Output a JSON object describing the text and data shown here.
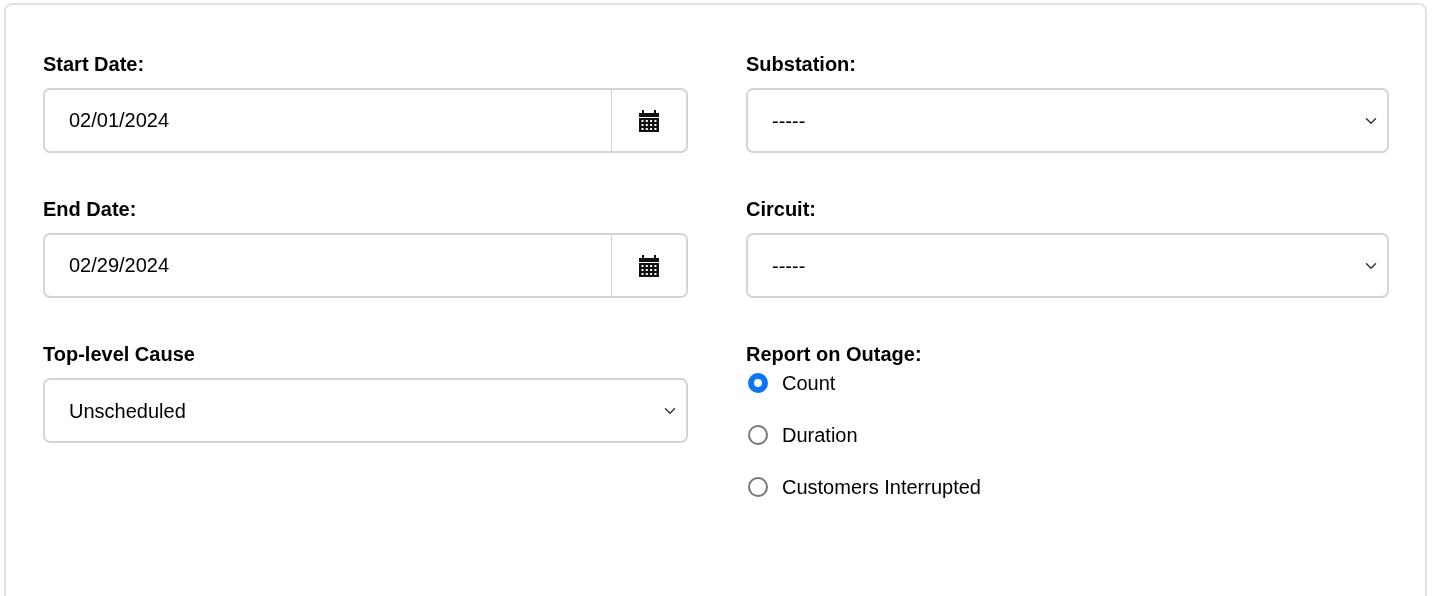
{
  "left": [
    {
      "kind": "date",
      "label": "Start Date:",
      "value": "02/01/2024"
    },
    {
      "kind": "date",
      "label": "End Date:",
      "value": "02/29/2024"
    },
    {
      "kind": "select",
      "label": "Top-level Cause",
      "value": "Unscheduled"
    }
  ],
  "right": [
    {
      "kind": "select",
      "label": "Substation:",
      "value": "-----"
    },
    {
      "kind": "select",
      "label": "Circuit:",
      "value": "-----"
    },
    {
      "kind": "radios",
      "label": "Report on Outage:",
      "options": [
        {
          "label": "Count",
          "selected": true
        },
        {
          "label": "Duration",
          "selected": false
        },
        {
          "label": "Customers Interrupted",
          "selected": false
        }
      ]
    }
  ]
}
